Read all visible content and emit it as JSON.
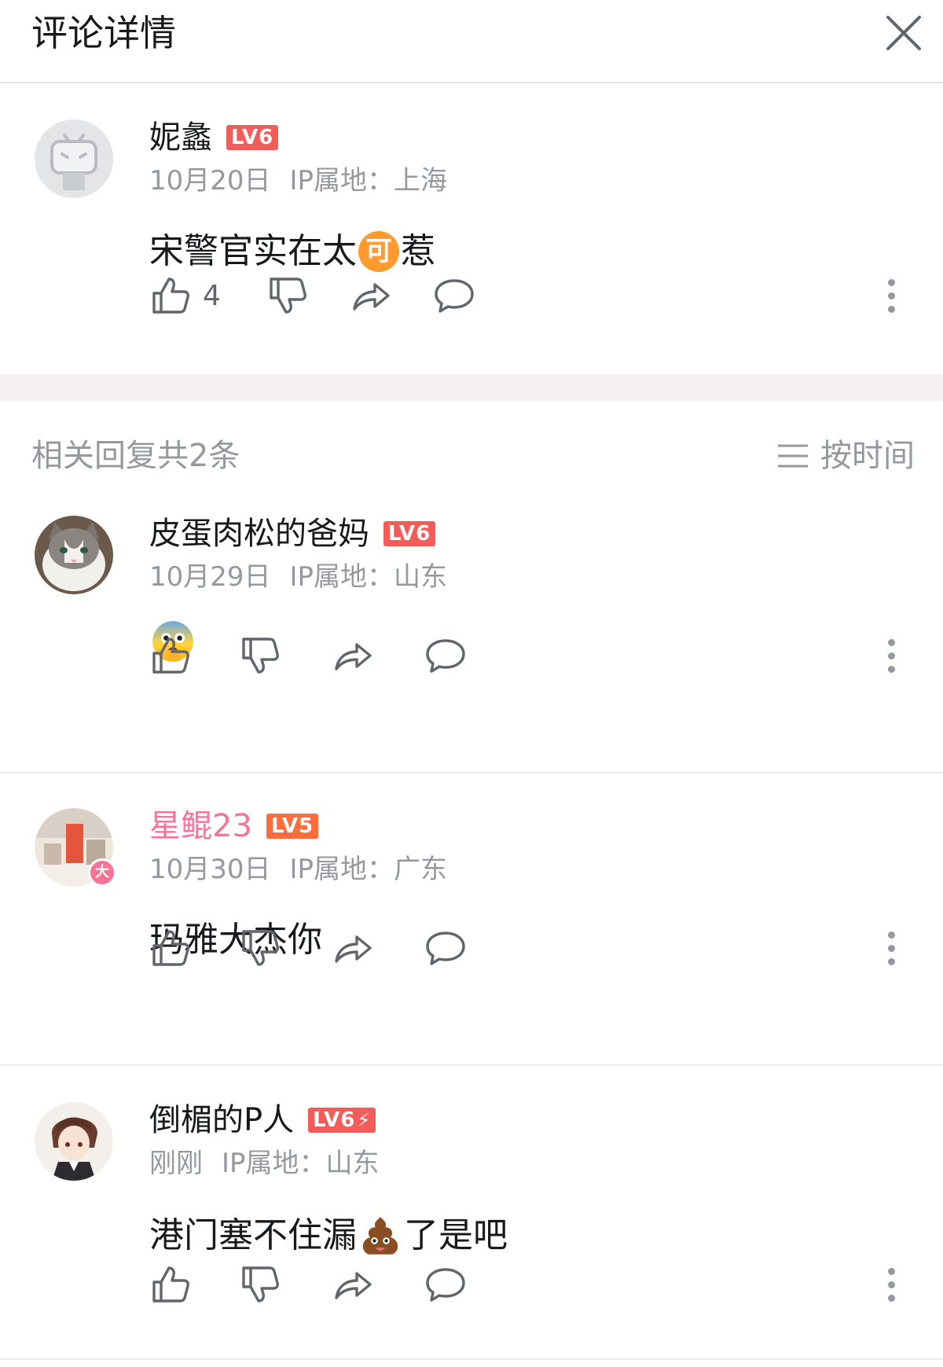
{
  "header": {
    "title": "评论详情"
  },
  "root_comment": {
    "user": "妮蠡",
    "level": "LV6",
    "date": "10月20日",
    "ip": "IP属地：上海",
    "content_before": "宋警官实在太",
    "content_emoji": "可",
    "content_after": "惹",
    "likes": "4"
  },
  "replies_header": {
    "count": "相关回复共2条",
    "sort_label": "按时间"
  },
  "replies": [
    {
      "user": "皮蛋肉松的爸妈",
      "level": "LV6",
      "date": "10月29日",
      "ip": "IP属地：山东",
      "emoji": "shocked-face"
    },
    {
      "user": "星鲲23",
      "level": "LV5",
      "badge": "大",
      "date": "10月30日",
      "ip": "IP属地：广东",
      "content": "玛雅大杰你"
    },
    {
      "user": "倒楣的P人",
      "level": "LV6",
      "date": "刚刚",
      "ip": "IP属地：山东",
      "content_before": "港门塞不住漏",
      "content_emoji": "poop",
      "content_after": "了是吧"
    }
  ],
  "colors": {
    "accent_pink": "#fb7299",
    "level_red": "#f25d59",
    "level_orange": "#ff6b3b",
    "meta_gray": "#9499a0",
    "section_gap": "#f6eff2"
  }
}
